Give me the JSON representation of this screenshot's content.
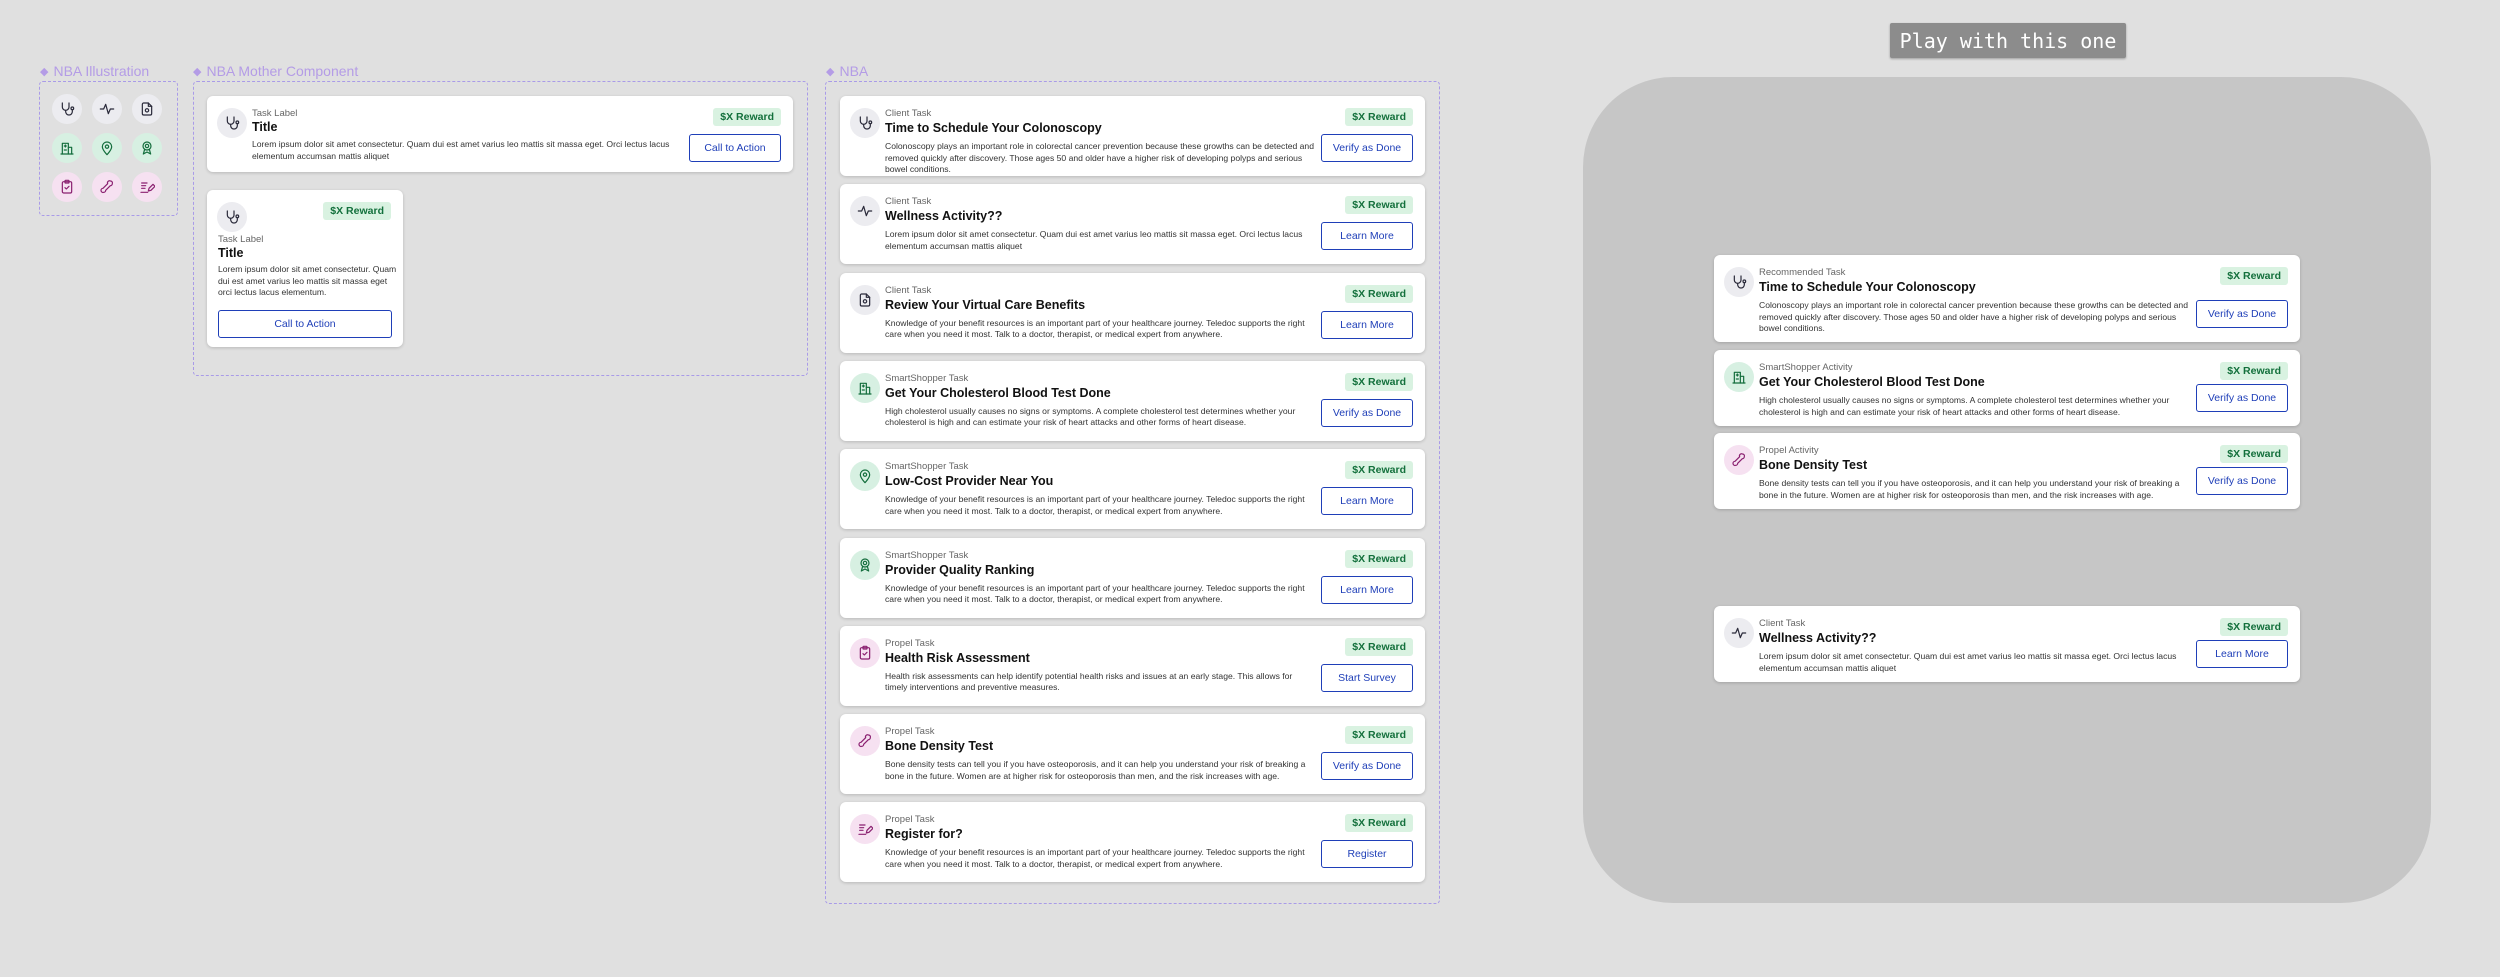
{
  "frames": {
    "illustration": "NBA Illustration",
    "mother": "NBA Mother Component",
    "nba": "NBA"
  },
  "play_button": "Play with this one",
  "reward": "$X Reward",
  "icons": [
    "stethoscope-icon",
    "pulse-icon",
    "document-icon",
    "clinic-icon",
    "location-pin-icon",
    "award-ribbon-icon",
    "clipboard-check-icon",
    "bone-icon",
    "edit-note-icon"
  ],
  "mother": {
    "wide": {
      "label": "Task Label",
      "title": "Title",
      "desc": "Lorem ipsum dolor sit amet consectetur. Quam dui est amet varius leo mattis sit massa eget. Orci lectus lacus elementum accumsan mattis aliquet",
      "cta": "Call to Action"
    },
    "compact": {
      "label": "Task Label",
      "title": "Title",
      "desc": "Lorem ipsum dolor sit amet consectetur. Quam dui est amet varius leo mattis sit massa eget orci lectus lacus elementum.",
      "cta": "Call to Action"
    }
  },
  "nba_cards": [
    {
      "icon": "stethoscope",
      "label": "Client Task",
      "title": "Time to Schedule Your Colonoscopy",
      "desc": "Colonoscopy plays an important role in colorectal cancer prevention because these growths can be detected and removed quickly after discovery. Those ages 50 and older have a higher risk of developing polyps and serious bowel conditions.",
      "cta": "Verify as Done"
    },
    {
      "icon": "pulse",
      "label": "Client Task",
      "title": "Wellness Activity??",
      "desc": "Lorem ipsum dolor sit amet consectetur. Quam dui est amet varius leo mattis sit massa eget. Orci lectus lacus elementum accumsan mattis aliquet",
      "cta": "Learn More"
    },
    {
      "icon": "document",
      "label": "Client Task",
      "title": "Review Your Virtual Care Benefits",
      "desc": "Knowledge of your benefit resources is an important part of your healthcare journey. Teledoc supports the right care when you need it most. Talk to a doctor, therapist, or medical expert from anywhere.",
      "cta": "Learn More"
    },
    {
      "icon": "clinic",
      "label": "SmartShopper Task",
      "title": "Get Your Cholesterol Blood Test Done",
      "desc": "High cholesterol usually causes no signs or symptoms. A complete cholesterol test determines whether your cholesterol is high and can estimate your risk of heart attacks and other forms of heart disease.",
      "cta": "Verify as Done"
    },
    {
      "icon": "pin",
      "label": "SmartShopper Task",
      "title": "Low-Cost Provider Near You",
      "desc": "Knowledge of your benefit resources is an important part of your healthcare journey. Teledoc supports the right care when you need it most. Talk to a doctor, therapist, or medical expert from anywhere.",
      "cta": "Learn More"
    },
    {
      "icon": "award",
      "label": "SmartShopper Task",
      "title": "Provider Quality Ranking",
      "desc": "Knowledge of your benefit resources is an important part of your healthcare journey. Teledoc supports the right care when you need it most. Talk to a doctor, therapist, or medical expert from anywhere.",
      "cta": "Learn More"
    },
    {
      "icon": "clipboard",
      "label": "Propel Task",
      "title": "Health Risk Assessment",
      "desc": "Health risk assessments can help identify potential health risks and issues at an early stage. This allows for timely interventions and preventive measures.",
      "cta": "Start Survey"
    },
    {
      "icon": "bone",
      "label": "Propel Task",
      "title": "Bone Density Test",
      "desc": "Bone density tests can tell you if you have osteoporosis, and it can help you understand your risk of breaking a bone in the future. Women are at higher risk for osteoporosis than men, and the risk increases with age.",
      "cta": "Verify as Done"
    },
    {
      "icon": "edit",
      "label": "Propel Task",
      "title": "Register for?",
      "desc": "Knowledge of your benefit resources is an important part of your healthcare journey. Teledoc supports the right care when you need it most. Talk to a doctor, therapist, or medical expert from anywhere.",
      "cta": "Register"
    }
  ],
  "play_cards": [
    {
      "icon": "stethoscope",
      "label": "Recommended Task",
      "title": "Time to Schedule Your Colonoscopy",
      "desc": "Colonoscopy plays an important role in colorectal cancer prevention because these growths can be detected and removed quickly after discovery. Those ages 50 and older have a higher risk of developing polyps and serious bowel conditions.",
      "cta": "Verify as Done"
    },
    {
      "icon": "clinic",
      "label": "SmartShopper Activity",
      "title": "Get Your Cholesterol Blood Test Done",
      "desc": "High cholesterol usually causes no signs or symptoms. A complete cholesterol test determines whether your cholesterol is high and can estimate your risk of heart attacks and other forms of heart disease.",
      "cta": "Verify as Done"
    },
    {
      "icon": "bone",
      "label": "Propel Activity",
      "title": "Bone Density Test",
      "desc": "Bone density tests can tell you if you have osteoporosis, and it can help you understand your risk of breaking a bone in the future. Women are at higher risk for osteoporosis than men, and the risk increases with age.",
      "cta": "Verify as Done"
    },
    {
      "icon": "pulse",
      "label": "Client Task",
      "title": "Wellness Activity??",
      "desc": "Lorem ipsum dolor sit amet consectetur. Quam dui est amet varius leo mattis sit massa eget. Orci lectus lacus elementum accumsan mattis aliquet",
      "cta": "Learn More"
    }
  ]
}
